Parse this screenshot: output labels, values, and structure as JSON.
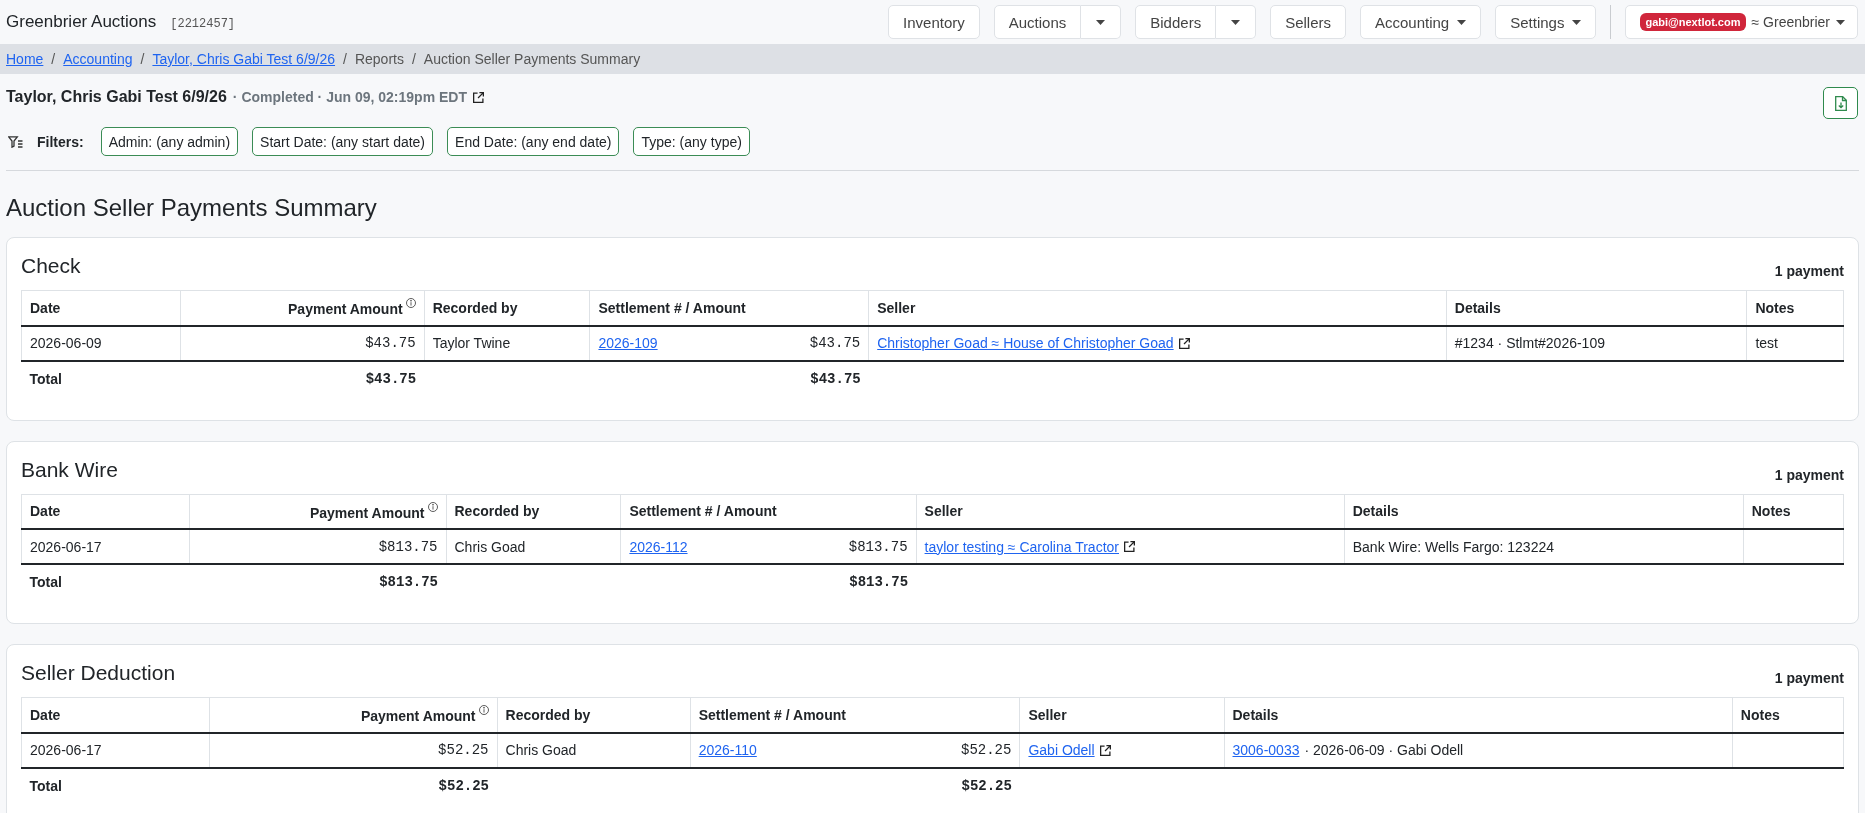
{
  "app": {
    "title": "Greenbrier Auctions",
    "id": "[2212457]"
  },
  "nav": {
    "items": [
      {
        "label": "Inventory",
        "kind": "plain"
      },
      {
        "label": "Auctions",
        "kind": "split"
      },
      {
        "label": "Bidders",
        "kind": "split"
      },
      {
        "label": "Sellers",
        "kind": "plain"
      },
      {
        "label": "Accounting",
        "kind": "dropdown"
      },
      {
        "label": "Settings",
        "kind": "dropdown"
      }
    ],
    "user": {
      "email": "gabi@nextlot.com",
      "org": "≈ Greenbrier"
    }
  },
  "breadcrumbs": [
    {
      "label": "Home",
      "kind": "link"
    },
    {
      "label": "/",
      "kind": "separator"
    },
    {
      "label": "Accounting",
      "kind": "link"
    },
    {
      "label": "/",
      "kind": "separator"
    },
    {
      "label": "Taylor, Chris Gabi Test 6/9/26",
      "kind": "link"
    },
    {
      "label": "/",
      "kind": "separator"
    },
    {
      "label": "Reports",
      "kind": "text"
    },
    {
      "label": "/",
      "kind": "separator"
    },
    {
      "label": "Auction Seller Payments Summary",
      "kind": "text"
    }
  ],
  "header": {
    "title": "Taylor, Chris Gabi Test 6/9/26",
    "subtitle": "· Completed · Jun 09, 02:19pm EDT"
  },
  "filters": {
    "label": "Filters:",
    "chips": [
      "Admin: (any admin)",
      "Start Date: (any start date)",
      "End Date: (any end date)",
      "Type: (any type)"
    ]
  },
  "page_title": "Auction Seller Payments Summary",
  "sections": [
    {
      "title": "Check",
      "count": "1 payment",
      "columns": [
        {
          "label": "Date",
          "info": false
        },
        {
          "label": "Payment Amount",
          "info": true
        },
        {
          "label": "Recorded by",
          "info": false
        },
        {
          "label": "Settlement # / Amount",
          "info": false
        },
        {
          "label": "Seller",
          "info": false
        },
        {
          "label": "Details",
          "info": false
        },
        {
          "label": "Notes",
          "info": false
        }
      ],
      "rows": [
        {
          "date": "2026-06-09",
          "payment_amount": "$43.75",
          "recorded_by": "Taylor Twine",
          "settlement": "2026-109",
          "settlement_amount": "$43.75",
          "seller": "Christopher Goad ≈ House of Christopher Goad",
          "details": "#1234 · Stlmt#2026-109",
          "notes": "test"
        }
      ],
      "total": {
        "label": "Total",
        "payment_amount": "$43.75",
        "settlement_amount": "$43.75"
      }
    },
    {
      "title": "Bank Wire",
      "count": "1 payment",
      "columns": [
        {
          "label": "Date",
          "info": false
        },
        {
          "label": "Payment Amount",
          "info": true
        },
        {
          "label": "Recorded by",
          "info": false
        },
        {
          "label": "Settlement # / Amount",
          "info": false
        },
        {
          "label": "Seller",
          "info": false
        },
        {
          "label": "Details",
          "info": false
        },
        {
          "label": "Notes",
          "info": false
        }
      ],
      "rows": [
        {
          "date": "2026-06-17",
          "payment_amount": "$813.75",
          "recorded_by": "Chris Goad",
          "settlement": "2026-112",
          "settlement_amount": "$813.75",
          "seller": "taylor testing ≈ Carolina Tractor",
          "details": "Bank Wire: Wells Fargo: 123224"
        }
      ],
      "total": {
        "label": "Total",
        "payment_amount": "$813.75",
        "settlement_amount": "$813.75"
      }
    },
    {
      "title": "Seller Deduction",
      "count": "1 payment",
      "columns": [
        {
          "label": "Date",
          "info": false
        },
        {
          "label": "Payment Amount",
          "info": true
        },
        {
          "label": "Recorded by",
          "info": false
        },
        {
          "label": "Settlement # / Amount",
          "info": false
        },
        {
          "label": "Seller",
          "info": false
        },
        {
          "label": "Details",
          "info": false
        },
        {
          "label": "Notes",
          "info": false
        }
      ],
      "rows": [
        {
          "date": "2026-06-17",
          "payment_amount": "$52.25",
          "recorded_by": "Chris Goad",
          "settlement": "2026-110",
          "settlement_amount": "$52.25",
          "seller": "Gabi Odell",
          "details_link": "3006-0033",
          "details": "· 2026-06-09 · Gabi Odell"
        }
      ],
      "total": {
        "label": "Total",
        "payment_amount": "$52.25",
        "settlement_amount": "$52.25"
      }
    }
  ]
}
